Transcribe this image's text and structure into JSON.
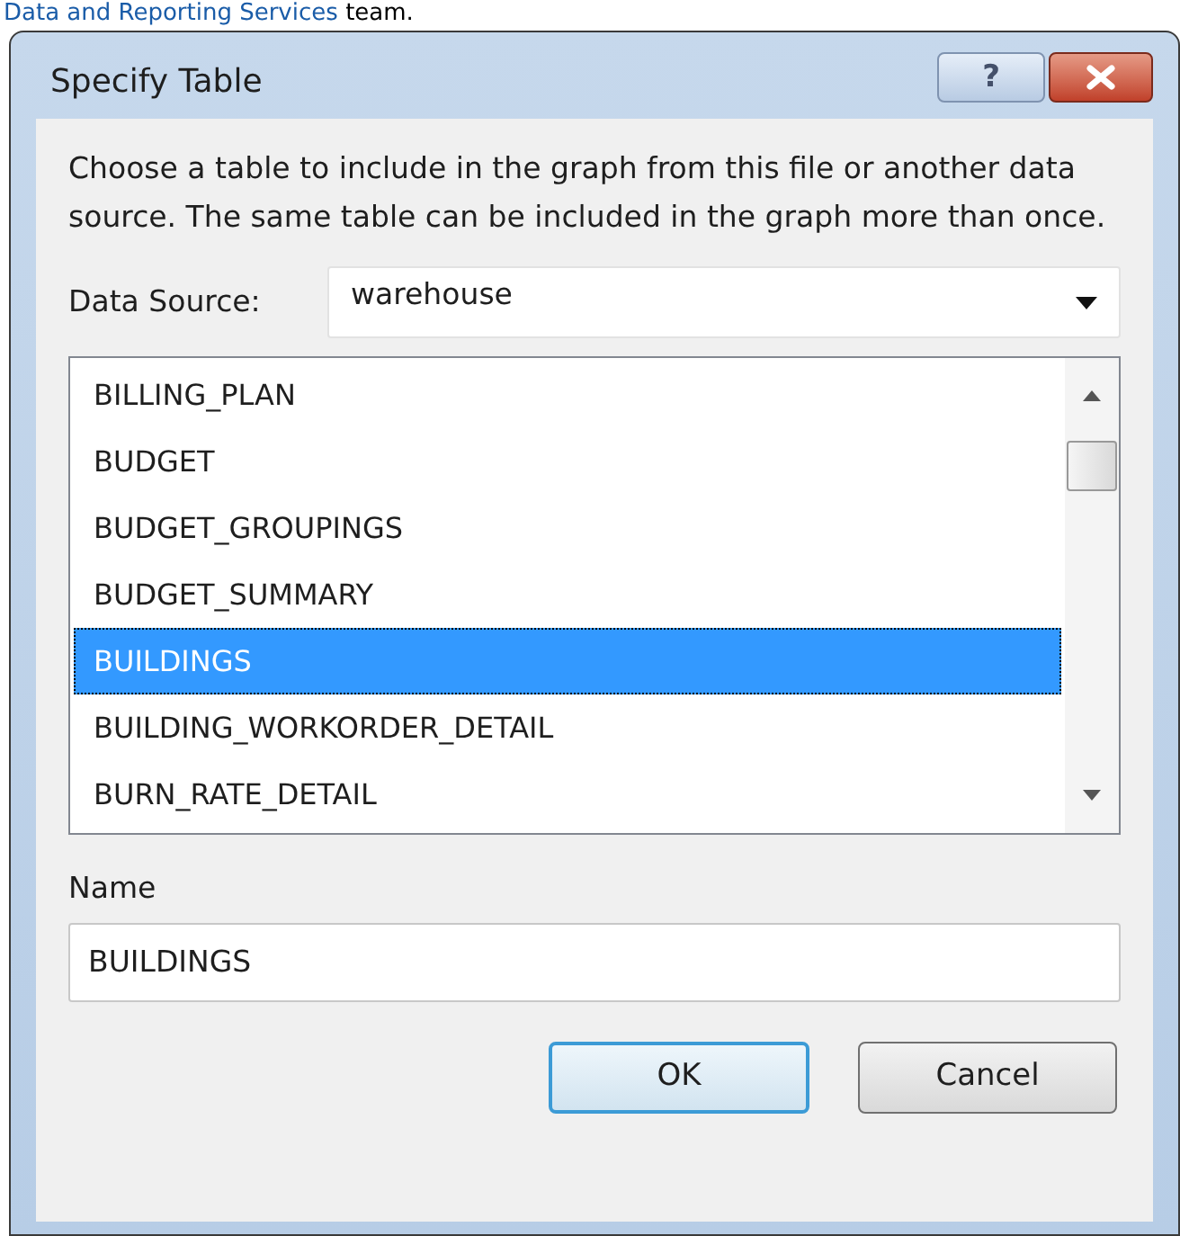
{
  "page_text": {
    "link": "Data and Reporting Services",
    "rest": "team."
  },
  "dialog": {
    "title": "Specify Table",
    "help_button": "?",
    "description": "Choose a table to include in the graph from this file or another data source.  The same table can be included in the graph more than once.",
    "data_source": {
      "label": "Data Source:",
      "value": "warehouse"
    },
    "tables": [
      {
        "label": "BILLING_PLAN",
        "selected": false
      },
      {
        "label": "BUDGET",
        "selected": false
      },
      {
        "label": "BUDGET_GROUPINGS",
        "selected": false
      },
      {
        "label": "BUDGET_SUMMARY",
        "selected": false
      },
      {
        "label": "BUILDINGS",
        "selected": true
      },
      {
        "label": "BUILDING_WORKORDER_DETAIL",
        "selected": false
      },
      {
        "label": "BURN_RATE_DETAIL",
        "selected": false
      }
    ],
    "name": {
      "label": "Name",
      "value": "BUILDINGS"
    },
    "buttons": [
      {
        "label": "OK",
        "default": true
      },
      {
        "label": "Cancel",
        "default": false
      }
    ]
  }
}
